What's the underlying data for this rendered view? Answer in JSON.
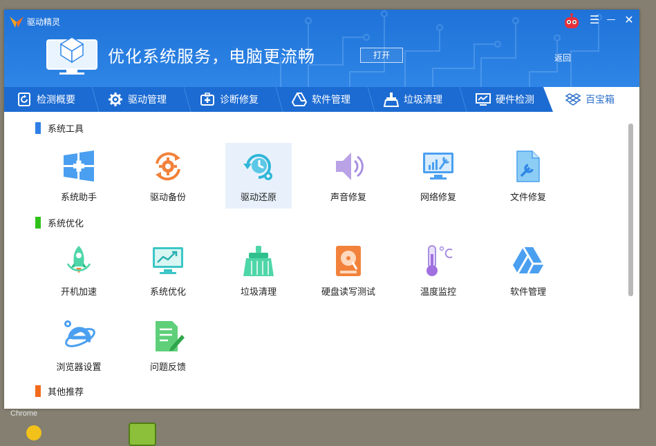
{
  "desktop": {
    "label": "Chrome"
  },
  "window": {
    "app_name": "驱动精灵",
    "headline": "优化系统服务，电脑更流畅",
    "open_button": "打开",
    "back_link": "返回",
    "controls": {
      "menu": "☰",
      "minimize": "—",
      "close": "✕"
    }
  },
  "tabs": [
    {
      "label": "检测概要",
      "icon": "refresh-doc-icon"
    },
    {
      "label": "驱动管理",
      "icon": "gear-icon"
    },
    {
      "label": "诊断修复",
      "icon": "medical-kit-icon"
    },
    {
      "label": "软件管理",
      "icon": "triangle-drive-icon"
    },
    {
      "label": "垃圾清理",
      "icon": "broom-icon"
    },
    {
      "label": "硬件检测",
      "icon": "monitor-chart-icon"
    },
    {
      "label": "百宝箱",
      "icon": "dropbox-icon",
      "active": true
    }
  ],
  "sections": [
    {
      "title": "系统工具",
      "color": "#2f7fe6",
      "items": [
        "系统助手",
        "驱动备份",
        "驱动还原",
        "声音修复",
        "网络修复",
        "文件修复"
      ]
    },
    {
      "title": "系统优化",
      "color": "#2fc11a",
      "items": [
        "开机加速",
        "系统优化",
        "垃圾清理",
        "硬盘读写测试",
        "温度监控",
        "软件管理",
        "浏览器设置",
        "问题反馈"
      ]
    },
    {
      "title": "其他推荐",
      "color": "#f26a1b",
      "items": []
    }
  ],
  "selected_item": "驱动还原"
}
